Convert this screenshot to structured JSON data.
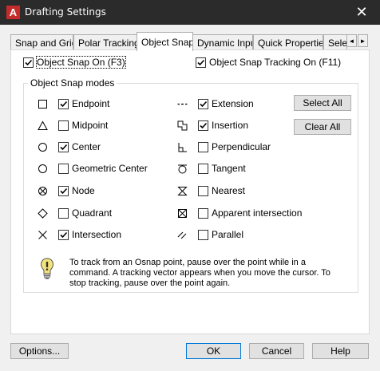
{
  "window": {
    "title": "Drafting Settings",
    "app_icon_letter": "A",
    "close_glyph": "✕"
  },
  "tabs": [
    {
      "label": "Snap and Grid"
    },
    {
      "label": "Polar Tracking"
    },
    {
      "label": "Object Snap",
      "active": true
    },
    {
      "label": "Dynamic Input"
    },
    {
      "label": "Quick Properties"
    },
    {
      "label": "Sele"
    }
  ],
  "tab_scroll": {
    "left": "◄",
    "right": "►"
  },
  "options_top": {
    "snap_on": {
      "label": "Object Snap On (F3)",
      "checked": true
    },
    "tracking_on": {
      "label": "Object Snap Tracking On (F11)",
      "checked": true
    }
  },
  "modes_group": {
    "title": "Object Snap modes"
  },
  "modes_left": [
    {
      "label": "Endpoint",
      "checked": true,
      "icon": "endpoint-icon"
    },
    {
      "label": "Midpoint",
      "checked": false,
      "icon": "midpoint-icon"
    },
    {
      "label": "Center",
      "checked": true,
      "icon": "center-icon"
    },
    {
      "label": "Geometric Center",
      "checked": false,
      "icon": "geometric-center-icon"
    },
    {
      "label": "Node",
      "checked": true,
      "icon": "node-icon"
    },
    {
      "label": "Quadrant",
      "checked": false,
      "icon": "quadrant-icon"
    },
    {
      "label": "Intersection",
      "checked": true,
      "icon": "intersection-icon"
    }
  ],
  "modes_right": [
    {
      "label": "Extension",
      "checked": true,
      "icon": "extension-icon"
    },
    {
      "label": "Insertion",
      "checked": true,
      "icon": "insertion-icon"
    },
    {
      "label": "Perpendicular",
      "checked": false,
      "icon": "perpendicular-icon"
    },
    {
      "label": "Tangent",
      "checked": false,
      "icon": "tangent-icon"
    },
    {
      "label": "Nearest",
      "checked": false,
      "icon": "nearest-icon"
    },
    {
      "label": "Apparent intersection",
      "checked": false,
      "icon": "apparent-intersection-icon"
    },
    {
      "label": "Parallel",
      "checked": false,
      "icon": "parallel-icon"
    }
  ],
  "side_buttons": {
    "select_all": "Select All",
    "clear_all": "Clear All"
  },
  "info_text": "To track from an Osnap point, pause over the point while in a command.  A tracking vector appears when you move the cursor.  To stop tracking, pause over the point again.",
  "footer": {
    "options": "Options...",
    "ok": "OK",
    "cancel": "Cancel",
    "help": "Help"
  },
  "colors": {
    "titlebar": "#2b2b2b",
    "accent": "#0078d7",
    "app_icon": "#c62b2b",
    "bulb": "#f3e37a"
  }
}
